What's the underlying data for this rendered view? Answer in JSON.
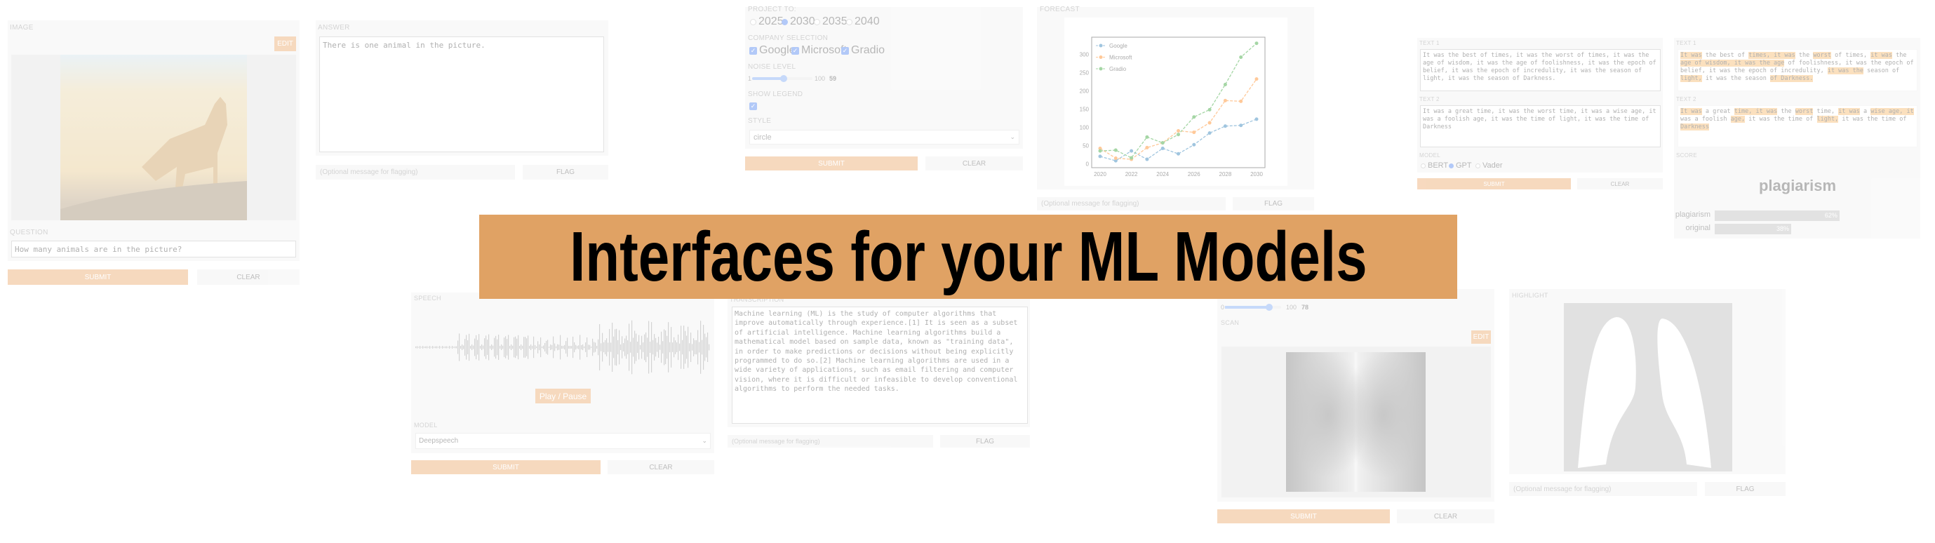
{
  "banner": {
    "title": "Interfaces for your ML Models",
    "color": "#E0A264"
  },
  "vqa": {
    "image_label": "IMAGE",
    "edit": "EDIT",
    "question_label": "QUESTION",
    "question_value": "How many animals are in the picture?",
    "submit": "SUBMIT",
    "clear": "CLEAR",
    "answer_label": "ANSWER",
    "answer_value": "There is one animal in the picture.",
    "flag_placeholder": "(Optional message for flagging)",
    "flag": "FLAG"
  },
  "forecast": {
    "project_label": "PROJECT TO:",
    "years": [
      "2025",
      "2030",
      "2035",
      "2040"
    ],
    "selected_year": "2030",
    "company_label": "COMPANY SELECTION",
    "companies": [
      "Google",
      "Microsoft",
      "Gradio"
    ],
    "noise_label": "NOISE LEVEL",
    "noise_min": "1",
    "noise_max": "100",
    "noise_value": "59",
    "legend_label": "SHOW LEGEND",
    "legend_checked": true,
    "style_label": "STYLE",
    "style_value": "circle",
    "submit": "SUBMIT",
    "clear": "CLEAR",
    "output_label": "FORECAST",
    "flag_placeholder": "(Optional message for flagging)",
    "flag": "FLAG"
  },
  "chart_data": {
    "type": "line",
    "x": [
      2020,
      2021,
      2022,
      2023,
      2024,
      2025,
      2026,
      2027,
      2028,
      2029,
      2030
    ],
    "xticks": [
      "2020",
      "2022",
      "2024",
      "2026",
      "2028",
      "2030"
    ],
    "yticks": [
      "0",
      "50",
      "100",
      "150",
      "200",
      "250",
      "300"
    ],
    "ylim": [
      0,
      340
    ],
    "grid": false,
    "legend": "top-left",
    "series": [
      {
        "name": "Google",
        "color": "#1f77b4",
        "values": [
          20,
          8,
          35,
          12,
          42,
          27,
          52,
          84,
          103,
          105,
          122
        ]
      },
      {
        "name": "Microsoft",
        "color": "#ff7f0e",
        "values": [
          42,
          15,
          12,
          44,
          57,
          90,
          86,
          112,
          173,
          171,
          232
        ]
      },
      {
        "name": "Gradio",
        "color": "#2ca02c",
        "values": [
          35,
          37,
          16,
          73,
          57,
          80,
          128,
          148,
          217,
          292,
          330
        ]
      }
    ]
  },
  "plag": {
    "text1_label": "TEXT 1",
    "text1": "It was the best of times, it was the worst of times, it was the age of wisdom, it was the age of foolishness, it was the epoch of belief, it was the epoch of incredulity, it was the season of light, it was the season of Darkness.",
    "text2_label": "TEXT 2",
    "text2": "It was a great time, it was the worst time, it was a wise age, it was a foolish age, it was the time of light, it was the time of Darkness",
    "model_label": "MODEL",
    "models": [
      "BERT",
      "GPT",
      "Vader"
    ],
    "selected_model": "GPT",
    "submit": "SUBMIT",
    "clear": "CLEAR",
    "out_text1": [
      [
        "It was",
        1
      ],
      [
        " the best of ",
        0
      ],
      [
        "times, it was",
        1
      ],
      [
        " the ",
        0
      ],
      [
        "worst",
        1
      ],
      [
        " of times, ",
        0
      ],
      [
        "it was",
        1
      ],
      [
        " the ",
        0
      ],
      [
        "age of wisdom, it was the age",
        1
      ],
      [
        " of foolishness, it was the epoch of belief, it was the epoch of incredulity, ",
        0
      ],
      [
        "it was the",
        1
      ],
      [
        " season of ",
        0
      ],
      [
        "light,",
        1
      ],
      [
        " it was the season ",
        0
      ],
      [
        "of Darkness.",
        1
      ]
    ],
    "out_text2": [
      [
        "It was",
        1
      ],
      [
        " a great ",
        0
      ],
      [
        "time, it was",
        1
      ],
      [
        " the ",
        0
      ],
      [
        "worst",
        1
      ],
      [
        " time, ",
        0
      ],
      [
        "it was",
        1
      ],
      [
        " a ",
        0
      ],
      [
        "wise age, it",
        1
      ],
      [
        " was a foolish ",
        0
      ],
      [
        "age,",
        1
      ],
      [
        " it was the time of ",
        0
      ],
      [
        "light,",
        1
      ],
      [
        " it was the time of ",
        0
      ],
      [
        "Darkness",
        1
      ]
    ],
    "score_label": "SCORE",
    "top_label": "plagiarism",
    "scores": [
      {
        "label": "plagiarism",
        "pct": "62%",
        "value": 0.62
      },
      {
        "label": "original",
        "pct": "38%",
        "value": 0.38
      }
    ]
  },
  "speech": {
    "label": "SPEECH",
    "play": "Play / Pause",
    "model_label": "MODEL",
    "model_value": "Deepspeech",
    "submit": "SUBMIT",
    "clear": "CLEAR",
    "output_label": "TRANSCRIPTION",
    "transcription": "Machine learning (ML) is the study of computer algorithms that improve automatically through experience.[1] It is seen as a subset of artificial intelligence. Machine learning algorithms build a mathematical model based on sample data, known as \"training data\", in order to make predictions or decisions without being explicitly programmed to do so.[2] Machine learning algorithms are used in a wide variety of applications, such as email filtering and computer vision, where it is difficult or infeasible to develop conventional algorithms to perform the needed tasks.",
    "flag_placeholder": "(Optional message for flagging)",
    "flag": "FLAG"
  },
  "xray": {
    "slider_min": "0",
    "slider_max": "100",
    "slider_value": "78",
    "scan_label": "SCAN",
    "edit": "EDIT",
    "submit": "SUBMIT",
    "clear": "CLEAR",
    "output_label": "HIGHLIGHT",
    "flag_placeholder": "(Optional message for flagging)",
    "flag": "FLAG"
  }
}
